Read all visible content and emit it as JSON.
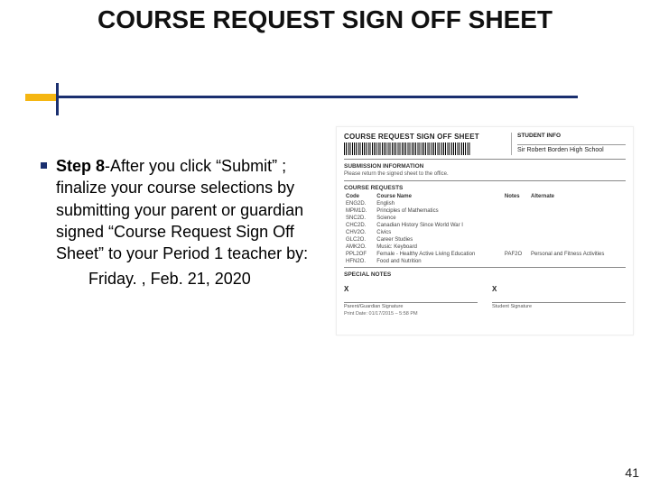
{
  "slide": {
    "title": "COURSE REQUEST SIGN OFF SHEET",
    "step_label": "Step 8",
    "step_sep": "-",
    "body": "After you click “Submit” ; finalize your course selections by submitting your parent or guardian signed “Course Request Sign Off Sheet” to your Period 1 teacher by:",
    "deadline": "Friday. , Feb. 21, 2020",
    "page_number": "41"
  },
  "form": {
    "title": "COURSE REQUEST SIGN OFF SHEET",
    "student_info_label": "STUDENT INFO",
    "school": "Sir Robert Borden High School",
    "submission_label": "SUBMISSION INFORMATION",
    "submission_text": "Please return the signed sheet to the office.",
    "course_requests_label": "COURSE REQUESTS",
    "columns": {
      "code": "Code",
      "name": "Course Name",
      "notes": "Notes",
      "alt": "Alternate"
    },
    "rows": [
      {
        "code": "ENG2D.",
        "name": "English",
        "notes": "",
        "alt": ""
      },
      {
        "code": "MPM1D.",
        "name": "Principles of Mathematics",
        "notes": "",
        "alt": ""
      },
      {
        "code": "SNC2D.",
        "name": "Science",
        "notes": "",
        "alt": ""
      },
      {
        "code": "CHC2D.",
        "name": "Canadian History Since World War I",
        "notes": "",
        "alt": ""
      },
      {
        "code": "CHV2O.",
        "name": "Civics",
        "notes": "",
        "alt": ""
      },
      {
        "code": "GLC2O.",
        "name": "Career Studies",
        "notes": "",
        "alt": ""
      },
      {
        "code": "AMK2O.",
        "name": "Music: Keyboard",
        "notes": "",
        "alt": ""
      },
      {
        "code": "PPL2OF",
        "name": "Female - Healthy Active Living Education",
        "notes": "PAF2O",
        "alt": "Personal and Fitness Activities"
      },
      {
        "code": "HFN2O.",
        "name": "Food and Nutrition",
        "notes": "",
        "alt": ""
      }
    ],
    "special_notes_label": "SPECIAL NOTES",
    "sig_parent": "Parent/Guardian Signature",
    "sig_student": "Student Signature",
    "print_date": "Print Date: 01/17/2015 – 5:58 PM"
  }
}
